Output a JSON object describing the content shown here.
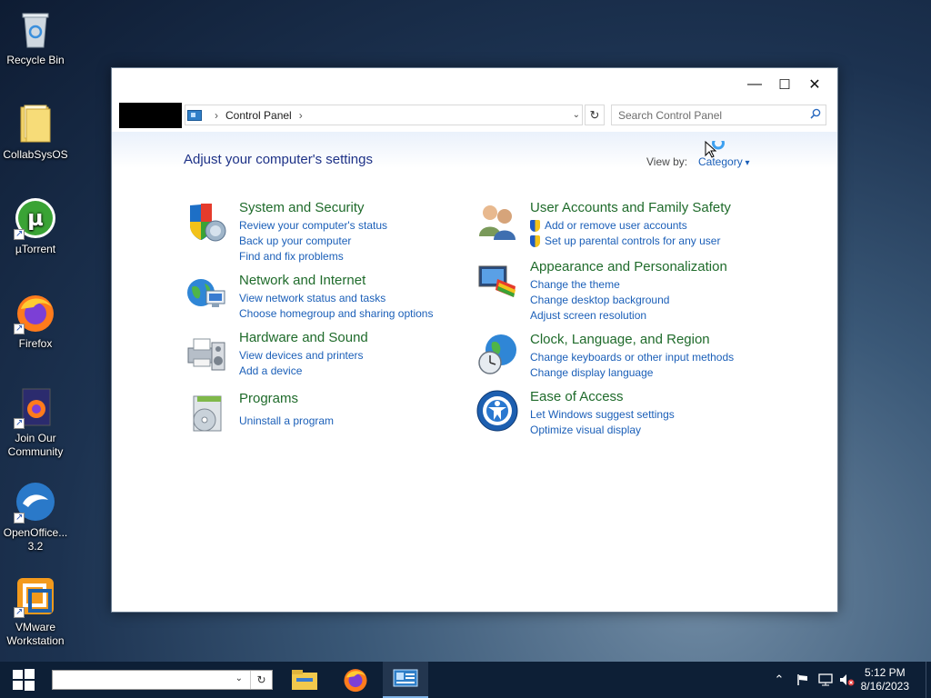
{
  "desktop": {
    "icons": [
      {
        "label": "Recycle Bin"
      },
      {
        "label": "CollabSysOS"
      },
      {
        "label": "µTorrent"
      },
      {
        "label": "Firefox"
      },
      {
        "label": "Join Our Community"
      },
      {
        "label": "OpenOffice... 3.2"
      },
      {
        "label": "VMware Workstation"
      }
    ]
  },
  "window": {
    "controls": {
      "minimize": "—",
      "maximize": "☐",
      "close": "✕"
    },
    "address": {
      "crumb": "Control Panel",
      "separator": "›"
    },
    "search": {
      "placeholder": "Search Control Panel"
    },
    "heading": "Adjust your computer's settings",
    "view_by": {
      "label": "View by:",
      "value": "Category"
    },
    "categories": [
      {
        "title": "System and Security",
        "icon": "shield-icon",
        "links": [
          "Review your computer's status",
          "Back up your computer",
          "Find and fix problems"
        ]
      },
      {
        "title": "Network and Internet",
        "icon": "network-globe-icon",
        "links": [
          "View network status and tasks",
          "Choose homegroup and sharing options"
        ]
      },
      {
        "title": "Hardware and Sound",
        "icon": "printer-speaker-icon",
        "links": [
          "View devices and printers",
          "Add a device"
        ]
      },
      {
        "title": "Programs",
        "icon": "programs-disc-icon",
        "links": [
          "Uninstall a program"
        ]
      },
      {
        "title": "User Accounts and Family Safety",
        "icon": "users-icon",
        "links": [
          "Add or remove user accounts",
          "Set up parental controls for any user"
        ]
      },
      {
        "title": "Appearance and Personalization",
        "icon": "monitor-paint-icon",
        "links": [
          "Change the theme",
          "Change desktop background",
          "Adjust screen resolution"
        ]
      },
      {
        "title": "Clock, Language, and Region",
        "icon": "clock-globe-icon",
        "links": [
          "Change keyboards or other input methods",
          "Change display language"
        ]
      },
      {
        "title": "Ease of Access",
        "icon": "ease-of-access-icon",
        "links": [
          "Let Windows suggest settings",
          "Optimize visual display"
        ]
      }
    ]
  },
  "taskbar": {
    "clock_time": "5:12 PM",
    "clock_date": "8/16/2023"
  }
}
